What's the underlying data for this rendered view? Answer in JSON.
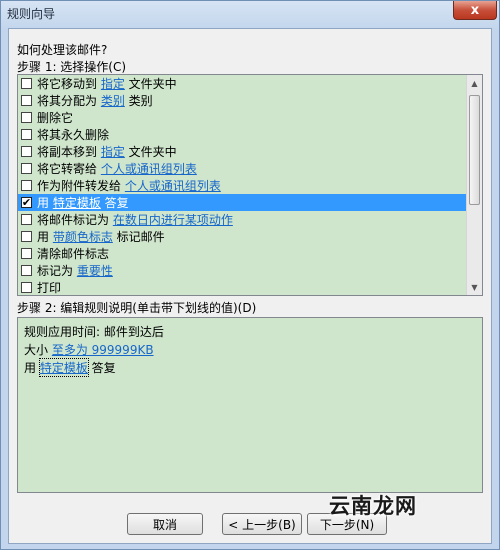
{
  "window": {
    "title": "规则向导",
    "close_label": "x"
  },
  "question": "如何处理该邮件?",
  "step1_label": "步骤 1: 选择操作(C)",
  "actions": [
    {
      "checked": false,
      "selected": false,
      "parts": [
        {
          "t": "将它移动到 "
        },
        {
          "t": "指定",
          "link": true
        },
        {
          "t": " 文件夹中"
        }
      ]
    },
    {
      "checked": false,
      "selected": false,
      "parts": [
        {
          "t": "将其分配为 "
        },
        {
          "t": "类别",
          "link": true
        },
        {
          "t": " 类别"
        }
      ]
    },
    {
      "checked": false,
      "selected": false,
      "parts": [
        {
          "t": "删除它"
        }
      ]
    },
    {
      "checked": false,
      "selected": false,
      "parts": [
        {
          "t": "将其永久删除"
        }
      ]
    },
    {
      "checked": false,
      "selected": false,
      "parts": [
        {
          "t": "将副本移到 "
        },
        {
          "t": "指定",
          "link": true
        },
        {
          "t": " 文件夹中"
        }
      ]
    },
    {
      "checked": false,
      "selected": false,
      "parts": [
        {
          "t": "将它转寄给 "
        },
        {
          "t": "个人或通讯组列表",
          "link": true
        }
      ]
    },
    {
      "checked": false,
      "selected": false,
      "parts": [
        {
          "t": "作为附件转发给 "
        },
        {
          "t": "个人或通讯组列表",
          "link": true
        }
      ]
    },
    {
      "checked": true,
      "selected": true,
      "parts": [
        {
          "t": "用 "
        },
        {
          "t": "特定模板",
          "link": true
        },
        {
          "t": " 答复"
        }
      ]
    },
    {
      "checked": false,
      "selected": false,
      "parts": [
        {
          "t": "将邮件标记为 "
        },
        {
          "t": "在数日内进行某项动作",
          "link": true
        }
      ]
    },
    {
      "checked": false,
      "selected": false,
      "parts": [
        {
          "t": "用 "
        },
        {
          "t": "带颜色标志",
          "link": true
        },
        {
          "t": " 标记邮件"
        }
      ]
    },
    {
      "checked": false,
      "selected": false,
      "parts": [
        {
          "t": "清除邮件标志"
        }
      ]
    },
    {
      "checked": false,
      "selected": false,
      "parts": [
        {
          "t": "标记为 "
        },
        {
          "t": "重要性",
          "link": true
        }
      ]
    },
    {
      "checked": false,
      "selected": false,
      "parts": [
        {
          "t": "打印"
        }
      ]
    }
  ],
  "step2_label": "步骤 2: 编辑规则说明(单击带下划线的值)(D)",
  "description": {
    "line1": "规则应用时间: 邮件到达后",
    "line2_prefix": "大小 ",
    "line2_link": "至多为 999999KB",
    "line3_prefix": "用 ",
    "line3_link": "特定模板",
    "line3_suffix": " 答复"
  },
  "buttons": {
    "cancel": "取消",
    "prev": "< 上一步(B)",
    "next": "下一步(N)"
  },
  "watermark": "云南龙网",
  "icons": {
    "check": "check-mark",
    "scroll_up": "chevron-up-icon",
    "scroll_down": "chevron-down-icon"
  }
}
